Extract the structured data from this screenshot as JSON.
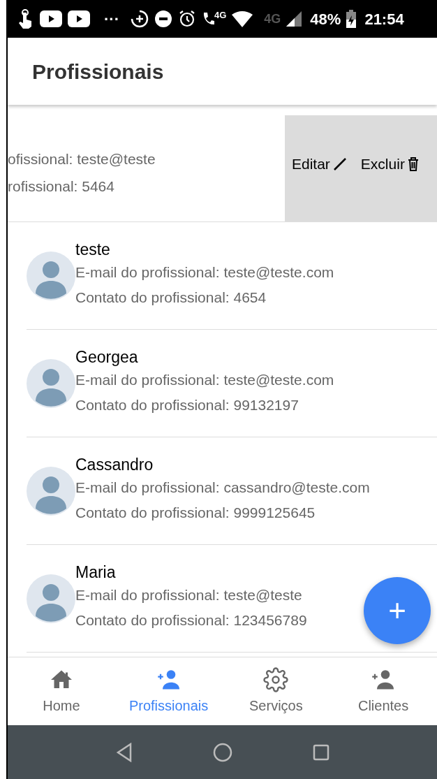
{
  "status_bar": {
    "dots": "···",
    "call_network": "4G",
    "network": "4G",
    "battery": "48%",
    "time": "21:54"
  },
  "header": {
    "title": "Profissionais"
  },
  "swiped_item": {
    "email": "ofissional: teste@teste",
    "contact": "rofissional: 5464",
    "actions": [
      {
        "kind": "edit",
        "label": "Editar"
      },
      {
        "kind": "delete",
        "label": "Excluir"
      }
    ]
  },
  "professionals": [
    {
      "name": "teste",
      "email": "E-mail do profissional: teste@teste.com",
      "contact": "Contato do profissional: 4654"
    },
    {
      "name": "Georgea",
      "email": "E-mail do profissional: teste@teste.com",
      "contact": "Contato do profissional: 99132197"
    },
    {
      "name": "Cassandro",
      "email": "E-mail do profissional: cassandro@teste.com",
      "contact": "Contato do profissional: 9999125645"
    },
    {
      "name": "Maria",
      "email": "E-mail do profissional: teste@teste",
      "contact": "Contato do profissional: 123456789"
    }
  ],
  "fab": {
    "label": "+"
  },
  "bottom_nav": [
    {
      "kind": "home",
      "label": "Home",
      "selected": false
    },
    {
      "kind": "add-person",
      "label": "Profissionais",
      "selected": true
    },
    {
      "kind": "gear",
      "label": "Serviços",
      "selected": false
    },
    {
      "kind": "add-person",
      "label": "Clientes",
      "selected": false
    }
  ]
}
